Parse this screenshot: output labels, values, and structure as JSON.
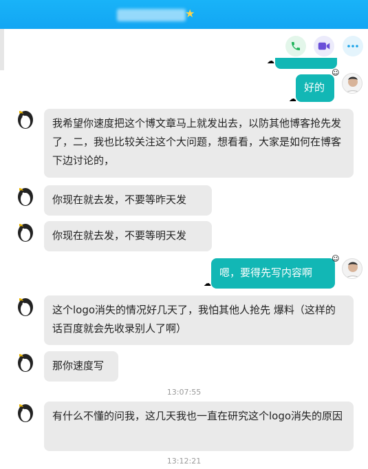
{
  "window": {
    "accent": "#19b3f8",
    "bubble_out_color": "#12b7b5",
    "bubble_in_color": "#eaeaea",
    "title_icon": "star-icon"
  },
  "toolbar": {
    "buttons": [
      {
        "icon": "phone-icon"
      },
      {
        "icon": "video-icon"
      },
      {
        "icon": "more-icon"
      }
    ]
  },
  "messages": [
    {
      "side": "out",
      "text": "好的"
    },
    {
      "side": "in",
      "text": "我希望你速度把这个博文章马上就发出去，以防其他博客抢先发了，二，我也比较关注这个大问题，想看看，大家是如何在博客下边讨论的，"
    },
    {
      "side": "in",
      "text": "你现在就去发，不要等昨天发"
    },
    {
      "side": "in",
      "text": "你现在就去发，不要等明天发"
    },
    {
      "side": "out",
      "text": "嗯，要得先写内容啊"
    },
    {
      "side": "in",
      "text": "这个logo消失的情况好几天了，我怕其他人抢先 爆料（这样的话百度就会先收录别人了啊）"
    },
    {
      "side": "in",
      "text": "那你速度写"
    },
    {
      "side": "in",
      "text": "有什么不懂的问我，这几天我也一直在研究这个logo消失的原因"
    }
  ],
  "timestamps": [
    "13:07:55",
    "13:12:21"
  ]
}
